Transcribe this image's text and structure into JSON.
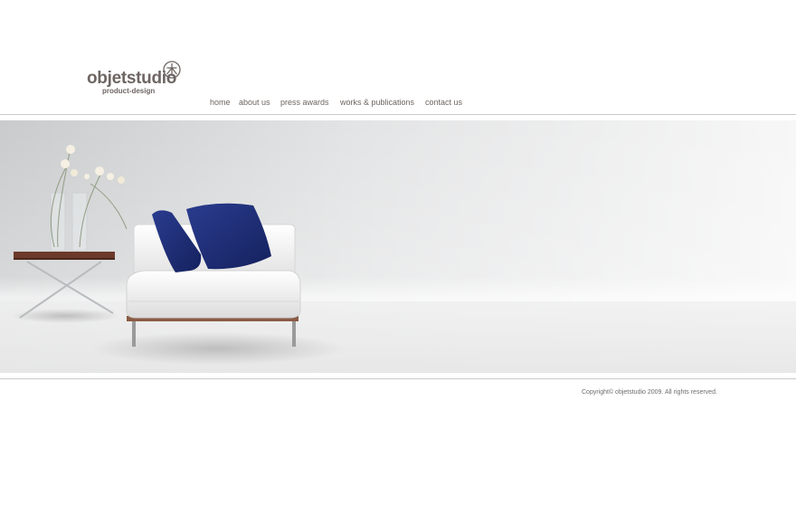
{
  "brand": {
    "name": "objetstudio",
    "tagline": "product-design",
    "mark_icon": "tree-glyph-icon"
  },
  "nav": {
    "items": [
      {
        "label": "home"
      },
      {
        "label": "about us"
      },
      {
        "label": "press awards"
      },
      {
        "label": "works & publications"
      },
      {
        "label": "contact us"
      }
    ]
  },
  "hero": {
    "description": "",
    "colors": {
      "sofa": "#f2f2f2",
      "cushions": "#1f2f7a",
      "table_top": "#6b3a2a"
    }
  },
  "footer": {
    "copyright": "Copyright© objetstudio 2009. All rights reserved."
  },
  "colors": {
    "text": "#6e6663",
    "rule": "#c9c9c9"
  }
}
